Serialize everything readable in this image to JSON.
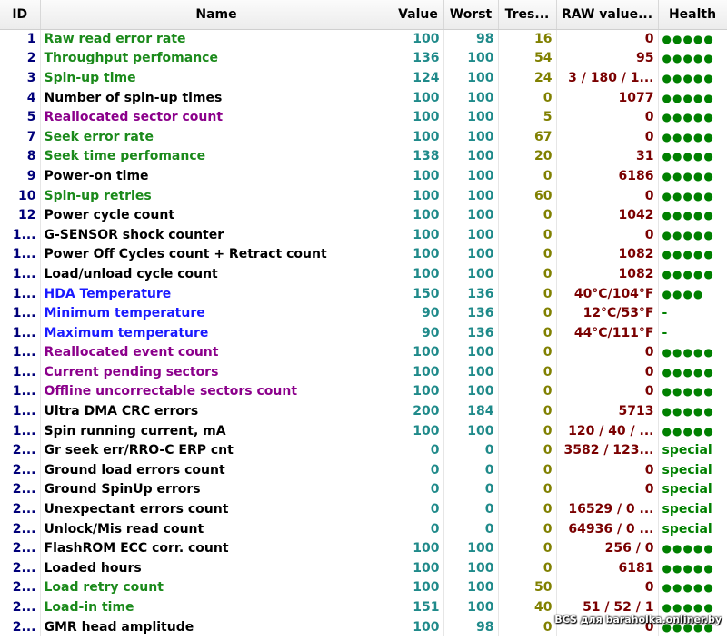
{
  "columns": {
    "id": "ID",
    "name": "Name",
    "value": "Value",
    "worst": "Worst",
    "tres": "Tres...",
    "raw": "RAW value...",
    "health": "Health"
  },
  "colors": {
    "name_green": "#1b8a1b",
    "name_purple": "#8b008b",
    "name_blue": "#1a1aff",
    "value_teal": "#1f8a8a",
    "raw_dark_red": "#7a0000",
    "raw_red": "#e8001c",
    "health_green": "#008000",
    "health_yellow": "#f0b400",
    "special_violet": "#9400d3"
  },
  "rows": [
    {
      "id": "1",
      "name": "Raw read error rate",
      "value": "100",
      "worst": "98",
      "tres": "16",
      "raw": "0",
      "health": "●●●●●"
    },
    {
      "id": "2",
      "name": "Throughput perfomance",
      "value": "136",
      "worst": "100",
      "tres": "54",
      "raw": "95",
      "health": "●●●●●"
    },
    {
      "id": "3",
      "name": "Spin-up time",
      "value": "124",
      "worst": "100",
      "tres": "24",
      "raw": "3 / 180 / 1...",
      "health": "●●●●●"
    },
    {
      "id": "4",
      "name": "Number of spin-up times",
      "value": "100",
      "worst": "100",
      "tres": "0",
      "raw": "1077",
      "health": "●●●●●"
    },
    {
      "id": "5",
      "name": "Reallocated sector count",
      "value": "100",
      "worst": "100",
      "tres": "5",
      "raw": "0",
      "health": "●●●●●"
    },
    {
      "id": "7",
      "name": "Seek error rate",
      "value": "100",
      "worst": "100",
      "tres": "67",
      "raw": "0",
      "health": "●●●●●"
    },
    {
      "id": "8",
      "name": "Seek time perfomance",
      "value": "138",
      "worst": "100",
      "tres": "20",
      "raw": "31",
      "health": "●●●●●"
    },
    {
      "id": "9",
      "name": "Power-on time",
      "value": "100",
      "worst": "100",
      "tres": "0",
      "raw": "6186",
      "health": "●●●●●"
    },
    {
      "id": "10",
      "name": "Spin-up retries",
      "value": "100",
      "worst": "100",
      "tres": "60",
      "raw": "0",
      "health": "●●●●●"
    },
    {
      "id": "12",
      "name": "Power cycle count",
      "value": "100",
      "worst": "100",
      "tres": "0",
      "raw": "1042",
      "health": "●●●●●"
    },
    {
      "id": "1...",
      "name": "G-SENSOR shock counter",
      "value": "100",
      "worst": "100",
      "tres": "0",
      "raw": "0",
      "health": "●●●●●"
    },
    {
      "id": "1...",
      "name": "Power Off Cycles count + Retract count",
      "value": "100",
      "worst": "100",
      "tres": "0",
      "raw": "1082",
      "health": "●●●●●"
    },
    {
      "id": "1...",
      "name": "Load/unload cycle count",
      "value": "100",
      "worst": "100",
      "tres": "0",
      "raw": "1082",
      "health": "●●●●●"
    },
    {
      "id": "1...",
      "name": "HDA Temperature",
      "value": "150",
      "worst": "136",
      "tres": "0",
      "raw": "40°C/104°F",
      "health": "●●●●"
    },
    {
      "id": "1...",
      "name": "Minimum temperature",
      "value": "90",
      "worst": "136",
      "tres": "0",
      "raw": "12°C/53°F",
      "health": "-"
    },
    {
      "id": "1...",
      "name": "Maximum temperature",
      "value": "90",
      "worst": "136",
      "tres": "0",
      "raw": "44°C/111°F",
      "health": "-"
    },
    {
      "id": "1...",
      "name": "Reallocated event count",
      "value": "100",
      "worst": "100",
      "tres": "0",
      "raw": "0",
      "health": "●●●●●"
    },
    {
      "id": "1...",
      "name": "Current pending sectors",
      "value": "100",
      "worst": "100",
      "tres": "0",
      "raw": "0",
      "health": "●●●●●"
    },
    {
      "id": "1...",
      "name": "Offline uncorrectable sectors count",
      "value": "100",
      "worst": "100",
      "tres": "0",
      "raw": "0",
      "health": "●●●●●"
    },
    {
      "id": "1...",
      "name": "Ultra DMA CRC errors",
      "value": "200",
      "worst": "184",
      "tres": "0",
      "raw": "5713",
      "health": "●●●●●"
    },
    {
      "id": "1...",
      "name": "Spin running current, mA",
      "value": "100",
      "worst": "100",
      "tres": "0",
      "raw": "120 / 40 / ...",
      "health": "●●●●●"
    },
    {
      "id": "2...",
      "name": "Gr seek err/RRO-C ERP cnt",
      "value": "0",
      "worst": "0",
      "tres": "0",
      "raw": "3582 / 123...",
      "health": "special"
    },
    {
      "id": "2...",
      "name": "Ground load errors count",
      "value": "0",
      "worst": "0",
      "tres": "0",
      "raw": "0",
      "health": "special"
    },
    {
      "id": "2...",
      "name": "Ground SpinUp errors",
      "value": "0",
      "worst": "0",
      "tres": "0",
      "raw": "0",
      "health": "special"
    },
    {
      "id": "2...",
      "name": "Unexpectant errors count",
      "value": "0",
      "worst": "0",
      "tres": "0",
      "raw": "16529 / 0 ...",
      "health": "special"
    },
    {
      "id": "2...",
      "name": "Unlock/Mis read count",
      "value": "0",
      "worst": "0",
      "tres": "0",
      "raw": "64936 / 0 ...",
      "health": "special"
    },
    {
      "id": "2...",
      "name": "FlashROM ECC corr. count",
      "value": "100",
      "worst": "100",
      "tres": "0",
      "raw": "256 / 0",
      "health": "●●●●●"
    },
    {
      "id": "2...",
      "name": "Loaded hours",
      "value": "100",
      "worst": "100",
      "tres": "0",
      "raw": "6181",
      "health": "●●●●●"
    },
    {
      "id": "2...",
      "name": "Load retry count",
      "value": "100",
      "worst": "100",
      "tres": "50",
      "raw": "0",
      "health": "●●●●●"
    },
    {
      "id": "2...",
      "name": "Load-in time",
      "value": "151",
      "worst": "100",
      "tres": "40",
      "raw": "51 / 52 / 1",
      "health": "●●●●●"
    },
    {
      "id": "2...",
      "name": "GMR head amplitude",
      "value": "100",
      "worst": "98",
      "tres": "0",
      "raw": "0",
      "health": "●●●●●"
    }
  ],
  "watermark": "BCS для baraholka.onliner.by"
}
